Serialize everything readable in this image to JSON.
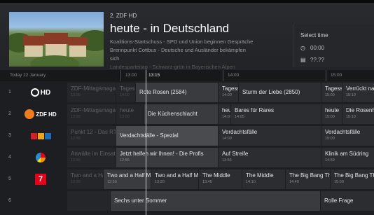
{
  "header": {
    "channel": "2. ZDF HD",
    "title": "heute - in Deutschland",
    "description": [
      "Koalitions-Startschuss - SPD und Union beginnen Gespräche",
      "Brennpunkt Cottbus - Deutsche und Ausländer bekämpfen",
      "sich",
      "Landesparteitag - Schwarz-grün in Bayerischen Alpen"
    ]
  },
  "select_time": {
    "label": "Select time",
    "time": "00:00",
    "date": "??.??"
  },
  "timebar": {
    "date": "Today 22 January",
    "times": [
      "13:00",
      "13:15",
      "14:00",
      "15:00"
    ]
  },
  "channels": [
    {
      "number": "1",
      "logo": "ARD HD",
      "logo_icon": "ard-hd-logo",
      "programs": [
        {
          "title": "ZDF-Mittagsmagazin",
          "time": "13:00",
          "state": "past"
        },
        {
          "title": "Tagesschau",
          "time": "14:00",
          "state": "past"
        },
        {
          "title": "Rote Rosen (2584)",
          "time": "",
          "state": "current"
        },
        {
          "title": "Tagesschau",
          "time": "14:00",
          "state": "future"
        },
        {
          "title": "Sturm der Liebe (2850)",
          "time": "",
          "state": "future"
        },
        {
          "title": "Tagesschau",
          "time": "15:00",
          "state": "future"
        },
        {
          "title": "Verrückt nach Meer",
          "time": "15:10",
          "state": "future"
        }
      ]
    },
    {
      "number": "2",
      "logo": "ZDF HD",
      "logo_icon": "zdf-hd-logo",
      "programs": [
        {
          "title": "ZDF-Mittagsmagazin",
          "time": "13:00",
          "state": "past"
        },
        {
          "title": "heute",
          "time": "13:00",
          "state": "past"
        },
        {
          "title": "Die Küchenschlacht",
          "time": "",
          "state": "current"
        },
        {
          "title": "heute",
          "time": "14:00",
          "state": "future"
        },
        {
          "title": "Bares für Rares",
          "time": "14:05",
          "state": "future"
        },
        {
          "title": "heute",
          "time": "15:00",
          "state": "future"
        },
        {
          "title": "Die Rosenheim-Cops",
          "time": "15:10",
          "state": "future"
        }
      ]
    },
    {
      "number": "3",
      "logo": "RTL",
      "logo_icon": "rtl-logo",
      "programs": [
        {
          "title": "Punkt 12 - Das RTL-Mittagsjournal",
          "time": "12:00",
          "state": "past"
        },
        {
          "title": "Verdachtsfälle - Spezial",
          "time": "",
          "state": "sel"
        },
        {
          "title": "Verdachtsfälle",
          "time": "14:00",
          "state": "future"
        },
        {
          "title": "Verdachtsfälle",
          "time": "15:00",
          "state": "future"
        }
      ]
    },
    {
      "number": "4",
      "logo": "SAT.1",
      "logo_icon": "sat1-logo",
      "programs": [
        {
          "title": "Anwälte im Einsatz",
          "time": "12:00",
          "state": "past"
        },
        {
          "title": "Jetzt helfen wir Ihnen! - Die Profis",
          "time": "12:55",
          "state": "current"
        },
        {
          "title": "Auf Streife",
          "time": "13:55",
          "state": "future"
        },
        {
          "title": "Klinik am Südring",
          "time": "14:59",
          "state": "future"
        }
      ]
    },
    {
      "number": "5",
      "logo": "ProSieben",
      "logo_icon": "prosieben-logo",
      "programs": [
        {
          "title": "Two and a Half Men",
          "time": "12:30",
          "state": "past"
        },
        {
          "title": "Two and a Half Men",
          "time": "12:50",
          "state": "current"
        },
        {
          "title": "Two and a Half Men",
          "time": "13:20",
          "state": "future"
        },
        {
          "title": "The Middle",
          "time": "13:45",
          "state": "future"
        },
        {
          "title": "The Middle",
          "time": "14:10",
          "state": "future"
        },
        {
          "title": "The Big Bang Theory",
          "time": "14:40",
          "state": "future"
        },
        {
          "title": "The Big Bang Theory",
          "time": "15:00",
          "state": "future"
        }
      ]
    },
    {
      "number": "6",
      "logo": "",
      "logo_icon": "channel-logo",
      "programs": [
        {
          "title": "",
          "time": "",
          "state": "past"
        },
        {
          "title": "Sechs unter Sommer",
          "time": "",
          "state": "current"
        },
        {
          "title": "Rolle Frage",
          "time": "",
          "state": "future"
        }
      ]
    }
  ]
}
